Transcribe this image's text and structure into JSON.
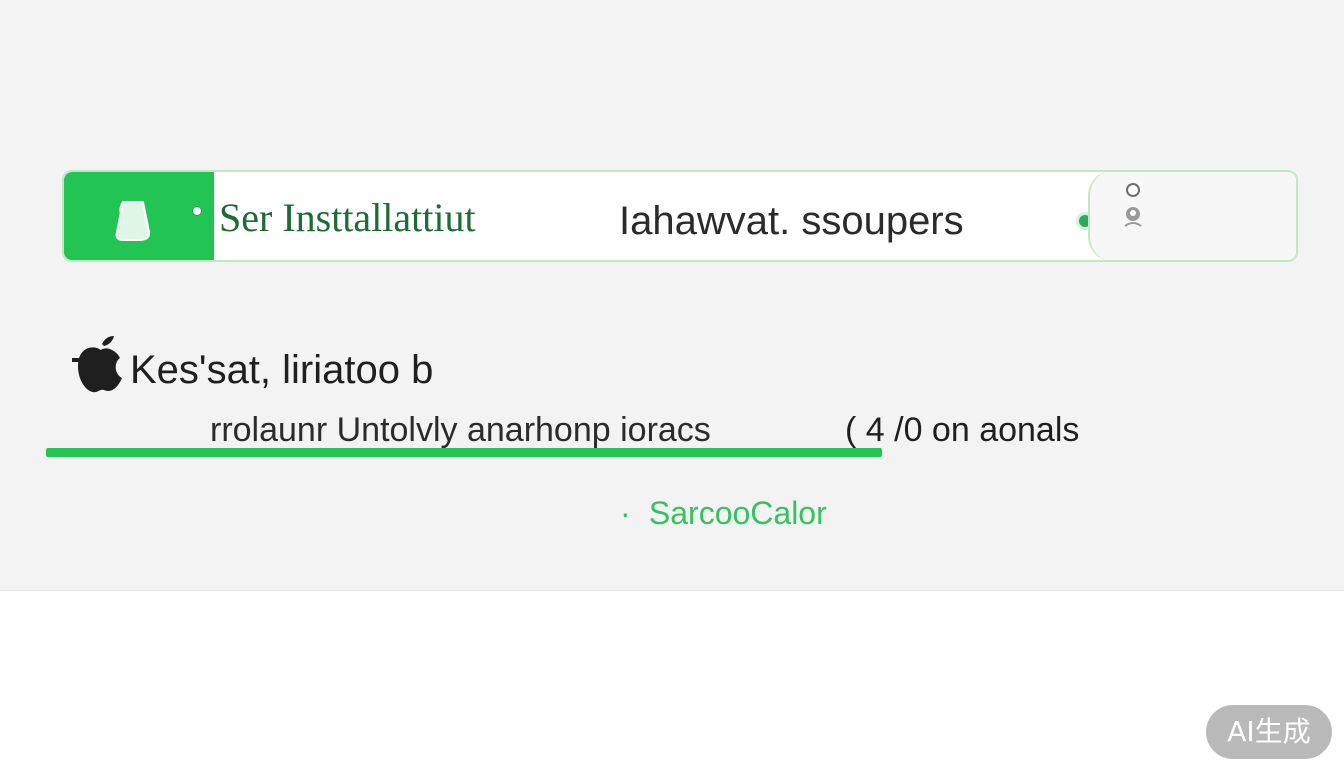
{
  "install_bar": {
    "title": "Ser Insttallattiut",
    "subtitle": "Iahawvat. ssoupers",
    "icon": "installer-icon",
    "status_icon": "status-dot-icon",
    "right_icon": "user-icon"
  },
  "main": {
    "heading": "Kes'sat, liriatoo b",
    "heading_icon": "apple-icon",
    "progress_label": "rrolaunr Untolvly anarhonp ioracs",
    "progress_value": "( 4 /0 on aonals",
    "link_label": "SarcooCalor",
    "link_bullet": "·"
  },
  "badge": {
    "label": "AI生成"
  },
  "colors": {
    "accent": "#22c553",
    "accent_dark": "#1d6b35",
    "link": "#36c261",
    "panel_bg": "#f3f3f3",
    "badge_bg": "#b9b9b9"
  }
}
